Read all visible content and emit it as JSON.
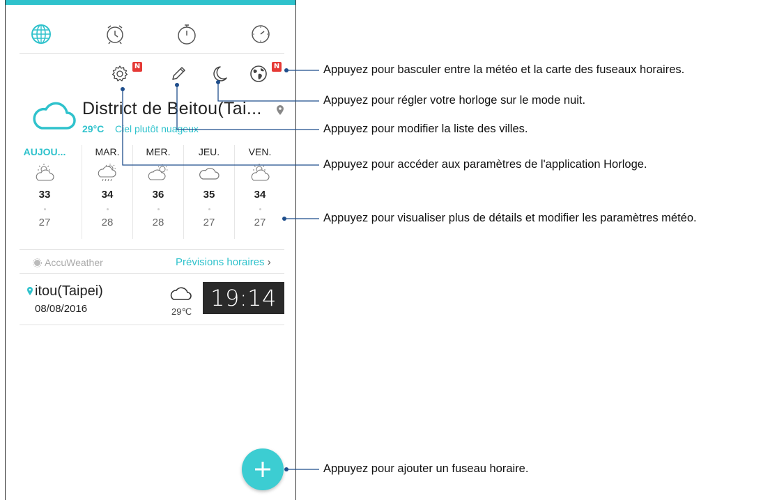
{
  "tabs": [
    {
      "icon": "world-clock-icon",
      "active": true
    },
    {
      "icon": "alarm-icon",
      "active": false
    },
    {
      "icon": "stopwatch-icon",
      "active": false
    },
    {
      "icon": "timer-icon",
      "active": false
    }
  ],
  "actions": {
    "settings_badge": "N",
    "world_badge": "N"
  },
  "city": {
    "name": "District de Beitou(Tai...",
    "temp": "29°C",
    "description": "Ciel plutôt nuageux"
  },
  "forecast": [
    {
      "day": "AUJOU...",
      "icon": "sun-cloud-icon",
      "high": "33",
      "low": "27"
    },
    {
      "day": "MAR.",
      "icon": "sun-cloud-rain-icon",
      "high": "34",
      "low": "28"
    },
    {
      "day": "MER.",
      "icon": "cloud-sun-icon",
      "high": "36",
      "low": "28"
    },
    {
      "day": "JEU.",
      "icon": "cloud-icon",
      "high": "35",
      "low": "27"
    },
    {
      "day": "VEN.",
      "icon": "sun-cloud-icon",
      "high": "34",
      "low": "27"
    }
  ],
  "accuweather": "AccuWeather",
  "hourly_link": "Prévisions horaires",
  "clock_entry": {
    "city": "itou(Taipei)",
    "date": "08/08/2016",
    "temp": "29℃",
    "time": "19:14"
  },
  "fab": {
    "icon": "plus-icon"
  },
  "callouts": [
    "Appuyez pour basculer entre la météo et la carte des fuseaux horaires.",
    "Appuyez pour régler votre horloge sur le mode nuit.",
    "Appuyez pour modifier la liste des villes.",
    "Appuyez pour accéder aux paramètres de l'application Horloge.",
    "Appuyez pour visualiser plus de détails et modifier les paramètres météo.",
    "Appuyez pour ajouter un fuseau horaire."
  ],
  "colors": {
    "accent": "#2fc2cc",
    "badge": "#e53935",
    "clock_bg": "#2a2a2a"
  }
}
